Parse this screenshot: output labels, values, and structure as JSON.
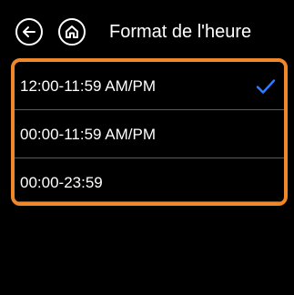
{
  "header": {
    "back_icon": "arrow-left-icon",
    "home_icon": "home-icon",
    "title": "Format de l'heure"
  },
  "options": [
    {
      "label": "12:00-11:59 AM/PM",
      "selected": true
    },
    {
      "label": "00:00-11:59 AM/PM",
      "selected": false
    },
    {
      "label": "00:00-23:59",
      "selected": false
    }
  ],
  "colors": {
    "background": "#000000",
    "highlight_border": "#f0882a",
    "check": "#2f7dff",
    "divider": "#5a5a5a"
  }
}
